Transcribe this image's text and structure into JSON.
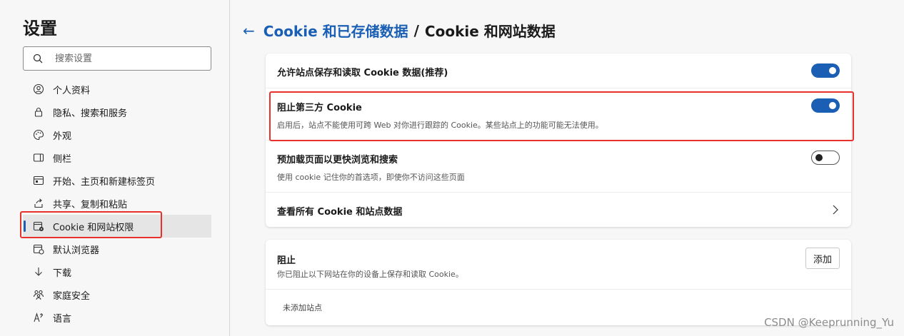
{
  "sidebar": {
    "title": "设置",
    "search_placeholder": "搜索设置",
    "items": [
      {
        "label": "个人资料",
        "icon": "profile-icon"
      },
      {
        "label": "隐私、搜索和服务",
        "icon": "lock-icon"
      },
      {
        "label": "外观",
        "icon": "palette-icon"
      },
      {
        "label": "侧栏",
        "icon": "sidebar-icon"
      },
      {
        "label": "开始、主页和新建标签页",
        "icon": "home-tab-icon"
      },
      {
        "label": "共享、复制和粘贴",
        "icon": "share-icon"
      },
      {
        "label": "Cookie 和网站权限",
        "icon": "cookie-settings-icon",
        "active": true
      },
      {
        "label": "默认浏览器",
        "icon": "browser-icon"
      },
      {
        "label": "下载",
        "icon": "download-icon"
      },
      {
        "label": "家庭安全",
        "icon": "family-icon"
      },
      {
        "label": "语言",
        "icon": "language-icon"
      }
    ]
  },
  "header": {
    "breadcrumb_link": "Cookie 和已存储数据",
    "separator": "/",
    "current": "Cookie 和网站数据"
  },
  "settings": {
    "allow_cookies": {
      "title": "允许站点保存和读取 Cookie 数据(推荐)",
      "enabled": true
    },
    "block_third_party": {
      "title": "阻止第三方 Cookie",
      "description": "启用后，站点不能使用可跨 Web 对你进行跟踪的 Cookie。某些站点上的功能可能无法使用。",
      "enabled": true
    },
    "preload": {
      "title": "预加载页面以更快浏览和搜索",
      "description": "使用 cookie 记住你的首选项，即使你不访问这些页面",
      "enabled": false
    },
    "view_all": {
      "title": "查看所有 Cookie 和站点数据"
    }
  },
  "block_section": {
    "title": "阻止",
    "description": "你已阻止以下网站在你的设备上保存和读取 Cookie。",
    "add_label": "添加",
    "empty_text": "未添加站点"
  },
  "watermark": "CSDN @Keeprunning_Yu",
  "colors": {
    "accent": "#1a5fb4",
    "highlight": "#e8312b"
  }
}
